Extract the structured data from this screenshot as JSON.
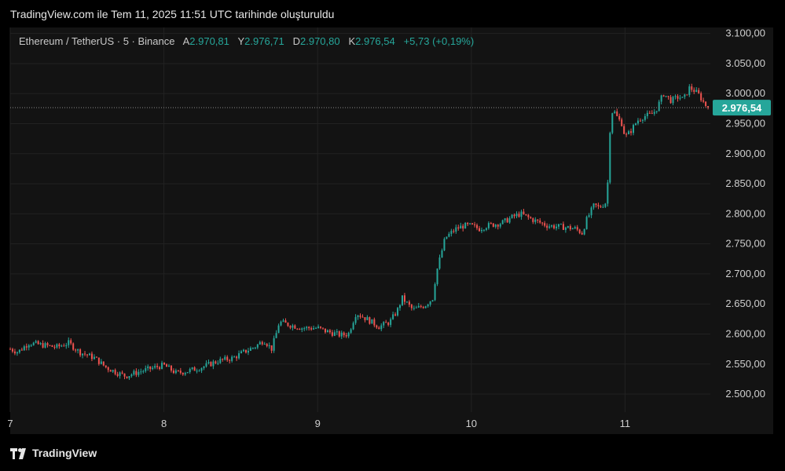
{
  "header": {
    "title": "TradingView.com ile Tem 11, 2025 11:51 UTC tarihinde oluşturuldu"
  },
  "legend": {
    "symbol": "Ethereum / TetherUS · 5 · Binance",
    "open_label": "A",
    "open": "2.970,81",
    "high_label": "Y",
    "high": "2.976,71",
    "low_label": "D",
    "low": "2.970,80",
    "close_label": "K",
    "close": "2.976,54",
    "change": "+5,73 (+0,19%)"
  },
  "footer": {
    "brand": "TradingView"
  },
  "colors": {
    "up": "#26a69a",
    "down": "#ef5350",
    "background": "#131313",
    "grid": "#222222"
  },
  "chart_data": {
    "type": "candlestick",
    "y_ticks": [
      "3.100,00",
      "3.050,00",
      "3.000,00",
      "2.950,00",
      "2.900,00",
      "2.850,00",
      "2.800,00",
      "2.750,00",
      "2.700,00",
      "2.650,00",
      "2.600,00",
      "2.550,00",
      "2.500,00"
    ],
    "y_tick_values": [
      3100,
      3050,
      3000,
      2950,
      2900,
      2850,
      2800,
      2750,
      2700,
      2650,
      2600,
      2550,
      2500
    ],
    "ylim": [
      2470,
      3110
    ],
    "x_ticks": [
      "7",
      "8",
      "9",
      "10",
      "11"
    ],
    "x_tick_values": [
      7,
      8,
      9,
      10,
      11
    ],
    "xlim": [
      7.0,
      11.555
    ],
    "last_price": 2976.54,
    "last_price_label": "2.976,54",
    "price_path": [
      [
        7.0,
        2575
      ],
      [
        7.05,
        2570
      ],
      [
        7.12,
        2585
      ],
      [
        7.2,
        2582
      ],
      [
        7.3,
        2578
      ],
      [
        7.38,
        2585
      ],
      [
        7.45,
        2570
      ],
      [
        7.55,
        2560
      ],
      [
        7.62,
        2545
      ],
      [
        7.7,
        2535
      ],
      [
        7.75,
        2530
      ],
      [
        7.85,
        2538
      ],
      [
        7.95,
        2545
      ],
      [
        8.0,
        2548
      ],
      [
        8.08,
        2535
      ],
      [
        8.15,
        2538
      ],
      [
        8.25,
        2545
      ],
      [
        8.35,
        2555
      ],
      [
        8.45,
        2560
      ],
      [
        8.52,
        2570
      ],
      [
        8.6,
        2580
      ],
      [
        8.65,
        2590
      ],
      [
        8.7,
        2575
      ],
      [
        8.73,
        2600
      ],
      [
        8.75,
        2620
      ],
      [
        8.82,
        2615
      ],
      [
        8.9,
        2610
      ],
      [
        9.0,
        2610
      ],
      [
        9.05,
        2605
      ],
      [
        9.15,
        2598
      ],
      [
        9.2,
        2600
      ],
      [
        9.25,
        2635
      ],
      [
        9.3,
        2628
      ],
      [
        9.35,
        2620
      ],
      [
        9.4,
        2612
      ],
      [
        9.47,
        2620
      ],
      [
        9.52,
        2640
      ],
      [
        9.55,
        2660
      ],
      [
        9.62,
        2640
      ],
      [
        9.7,
        2648
      ],
      [
        9.75,
        2660
      ],
      [
        9.77,
        2700
      ],
      [
        9.8,
        2730
      ],
      [
        9.83,
        2760
      ],
      [
        9.9,
        2775
      ],
      [
        9.95,
        2780
      ],
      [
        10.0,
        2780
      ],
      [
        10.05,
        2775
      ],
      [
        10.1,
        2780
      ],
      [
        10.2,
        2785
      ],
      [
        10.27,
        2795
      ],
      [
        10.32,
        2800
      ],
      [
        10.4,
        2790
      ],
      [
        10.5,
        2780
      ],
      [
        10.6,
        2778
      ],
      [
        10.68,
        2775
      ],
      [
        10.72,
        2768
      ],
      [
        10.75,
        2790
      ],
      [
        10.8,
        2815
      ],
      [
        10.83,
        2810
      ],
      [
        10.88,
        2820
      ],
      [
        10.89,
        2865
      ],
      [
        10.9,
        2935
      ],
      [
        10.92,
        2975
      ],
      [
        10.95,
        2960
      ],
      [
        10.98,
        2950
      ],
      [
        11.0,
        2928
      ],
      [
        11.03,
        2935
      ],
      [
        11.08,
        2955
      ],
      [
        11.12,
        2962
      ],
      [
        11.17,
        2965
      ],
      [
        11.2,
        2972
      ],
      [
        11.25,
        3000
      ],
      [
        11.3,
        2988
      ],
      [
        11.35,
        2995
      ],
      [
        11.38,
        2990
      ],
      [
        11.42,
        3010
      ],
      [
        11.45,
        3005
      ],
      [
        11.48,
        2998
      ],
      [
        11.5,
        2990
      ],
      [
        11.52,
        2982
      ],
      [
        11.54,
        2976.54
      ]
    ]
  }
}
